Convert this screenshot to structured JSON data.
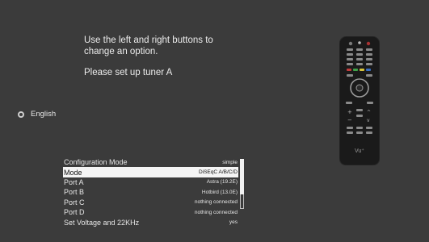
{
  "instructions": {
    "line1": "Use the left and right buttons to",
    "line2": "change an option.",
    "line3": "Please set up tuner A"
  },
  "language": {
    "label": "English",
    "icon": "radio-icon"
  },
  "remote": {
    "brand": "Vu⁺"
  },
  "config": {
    "rows": [
      {
        "label": "Configuration Mode",
        "value": "simple"
      },
      {
        "label": "Mode",
        "value": "DiSEqC A/B/C/D"
      },
      {
        "label": "Port A",
        "value": "Astra (19.2E)"
      },
      {
        "label": "Port B",
        "value": "Hotbird (13.0E)"
      },
      {
        "label": "Port C",
        "value": "nothing connected"
      },
      {
        "label": "Port D",
        "value": "nothing connected"
      },
      {
        "label": "Set Voltage and 22KHz",
        "value": "yes"
      }
    ],
    "selected_index": 1
  },
  "colors": {
    "background": "#3b3b3b",
    "highlight": "#f4f4f4",
    "text": "#e8e8e8",
    "remote_body": "#1a1a1a"
  }
}
